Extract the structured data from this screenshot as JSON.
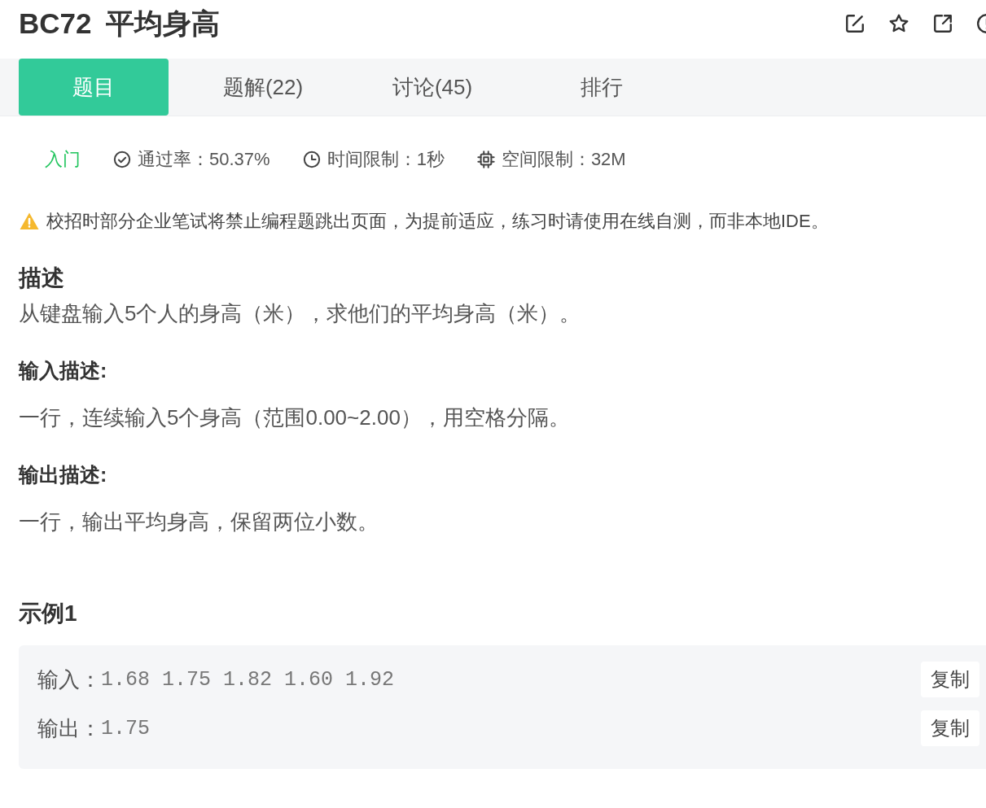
{
  "title": {
    "code": "BC72",
    "name": "平均身高"
  },
  "tabs": [
    {
      "label": "题目",
      "selected": true
    },
    {
      "label": "题解(22)",
      "selected": false
    },
    {
      "label": "讨论(45)",
      "selected": false
    },
    {
      "label": "排行",
      "selected": false
    }
  ],
  "meta": {
    "difficulty": "入门",
    "items": [
      {
        "kind": "pass",
        "text": "通过率：50.37%"
      },
      {
        "kind": "time",
        "text": "时间限制：1秒"
      },
      {
        "kind": "memory",
        "text": "空间限制：32M"
      }
    ]
  },
  "notice": "校招时部分企业笔试将禁止编程题跳出页面，为提前适应，练习时请使用在线自测，而非本地IDE。",
  "sections": [
    {
      "kind": "main",
      "heading": "描述",
      "text": "从键盘输入5个人的身高（米），求他们的平均身高（米）。"
    },
    {
      "kind": "sub",
      "heading": "输入描述:",
      "text": "一行，连续输入5个身高（范围0.00~2.00），用空格分隔。"
    },
    {
      "kind": "sub",
      "heading": "输出描述:",
      "text": "一行，输出平均身高，保留两位小数。"
    }
  ],
  "example": {
    "heading": "示例1",
    "rows": [
      {
        "label": "输入：",
        "value": "1.68 1.75 1.82 1.60 1.92",
        "button": "复制"
      },
      {
        "label": "输出：",
        "value": "1.75",
        "button": "复制"
      }
    ]
  }
}
